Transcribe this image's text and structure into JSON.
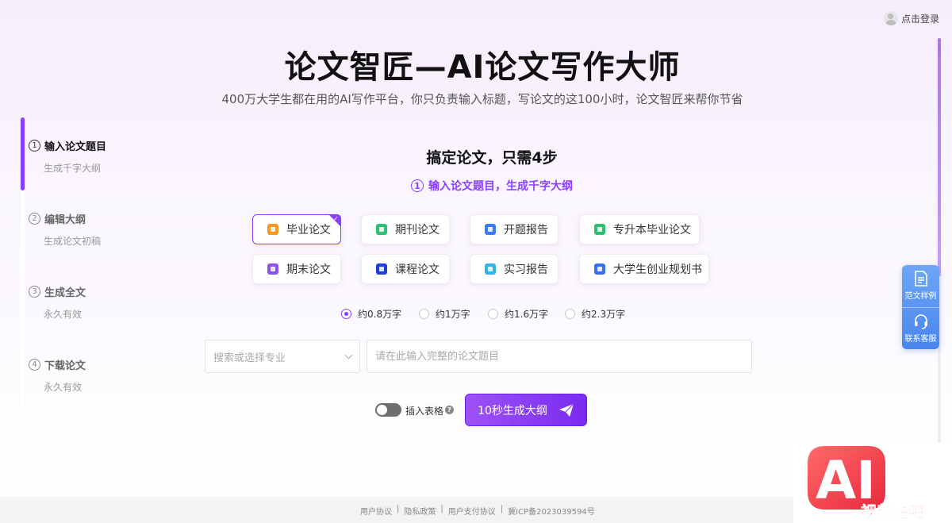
{
  "login": {
    "label": "点击登录"
  },
  "header": {
    "title": "论文智匠—AI论文写作大师",
    "subtitle": "400万大学生都在用的AI写作平台，你只负责输入标题，写论文的这100小时，论文智匠来帮你节省"
  },
  "steps": [
    {
      "num": "1",
      "title": "输入论文题目",
      "desc": "生成千字大纲",
      "active": true
    },
    {
      "num": "2",
      "title": "编辑大纲",
      "desc": "生成论文初稿"
    },
    {
      "num": "3",
      "title": "生成全文",
      "desc": "永久有效"
    },
    {
      "num": "4",
      "title": "下载论文",
      "desc": "永久有效"
    }
  ],
  "main": {
    "section_title": "搞定论文，只需4步",
    "section_sub_num": "1",
    "section_sub": "输入论文题目，生成千字大纲",
    "types": [
      {
        "label": "毕业论文",
        "icon_color": "#f59a23",
        "selected": true
      },
      {
        "label": "期刊论文",
        "icon_color": "#2fbf71"
      },
      {
        "label": "开题报告",
        "icon_color": "#3a7bf0"
      },
      {
        "label": "专升本毕业论文",
        "icon_color": "#2fbf71"
      },
      {
        "label": "期末论文",
        "icon_color": "#8a52e8"
      },
      {
        "label": "课程论文",
        "icon_color": "#1f3fd6"
      },
      {
        "label": "实习报告",
        "icon_color": "#2fb5e8"
      },
      {
        "label": "大学生创业规划书",
        "icon_color": "#3a6ff0"
      }
    ],
    "word_counts": [
      {
        "label": "约0.8万字",
        "checked": true
      },
      {
        "label": "约1万字"
      },
      {
        "label": "约1.6万字"
      },
      {
        "label": "约2.3万字"
      }
    ],
    "major_select": {
      "placeholder": "搜索或选择专业"
    },
    "topic_input": {
      "placeholder": "请在此输入完整的论文题目",
      "value": ""
    },
    "table_toggle": {
      "label": "插入表格",
      "on": false
    },
    "help_glyph": "?",
    "generate_label": "10秒生成大纲"
  },
  "float_panel": {
    "samples_label": "范文样例",
    "service_label": "联系客服"
  },
  "footer": {
    "links": [
      "用户协议",
      "隐私政策",
      "用户支付协议",
      "冀ICP备2023039594号"
    ],
    "separator": "|"
  },
  "watermark": {
    "big": "AI",
    "small": "视频贴吧"
  },
  "colors": {
    "accent": "#8a3ffc",
    "float_panel": "#5a95f2"
  }
}
